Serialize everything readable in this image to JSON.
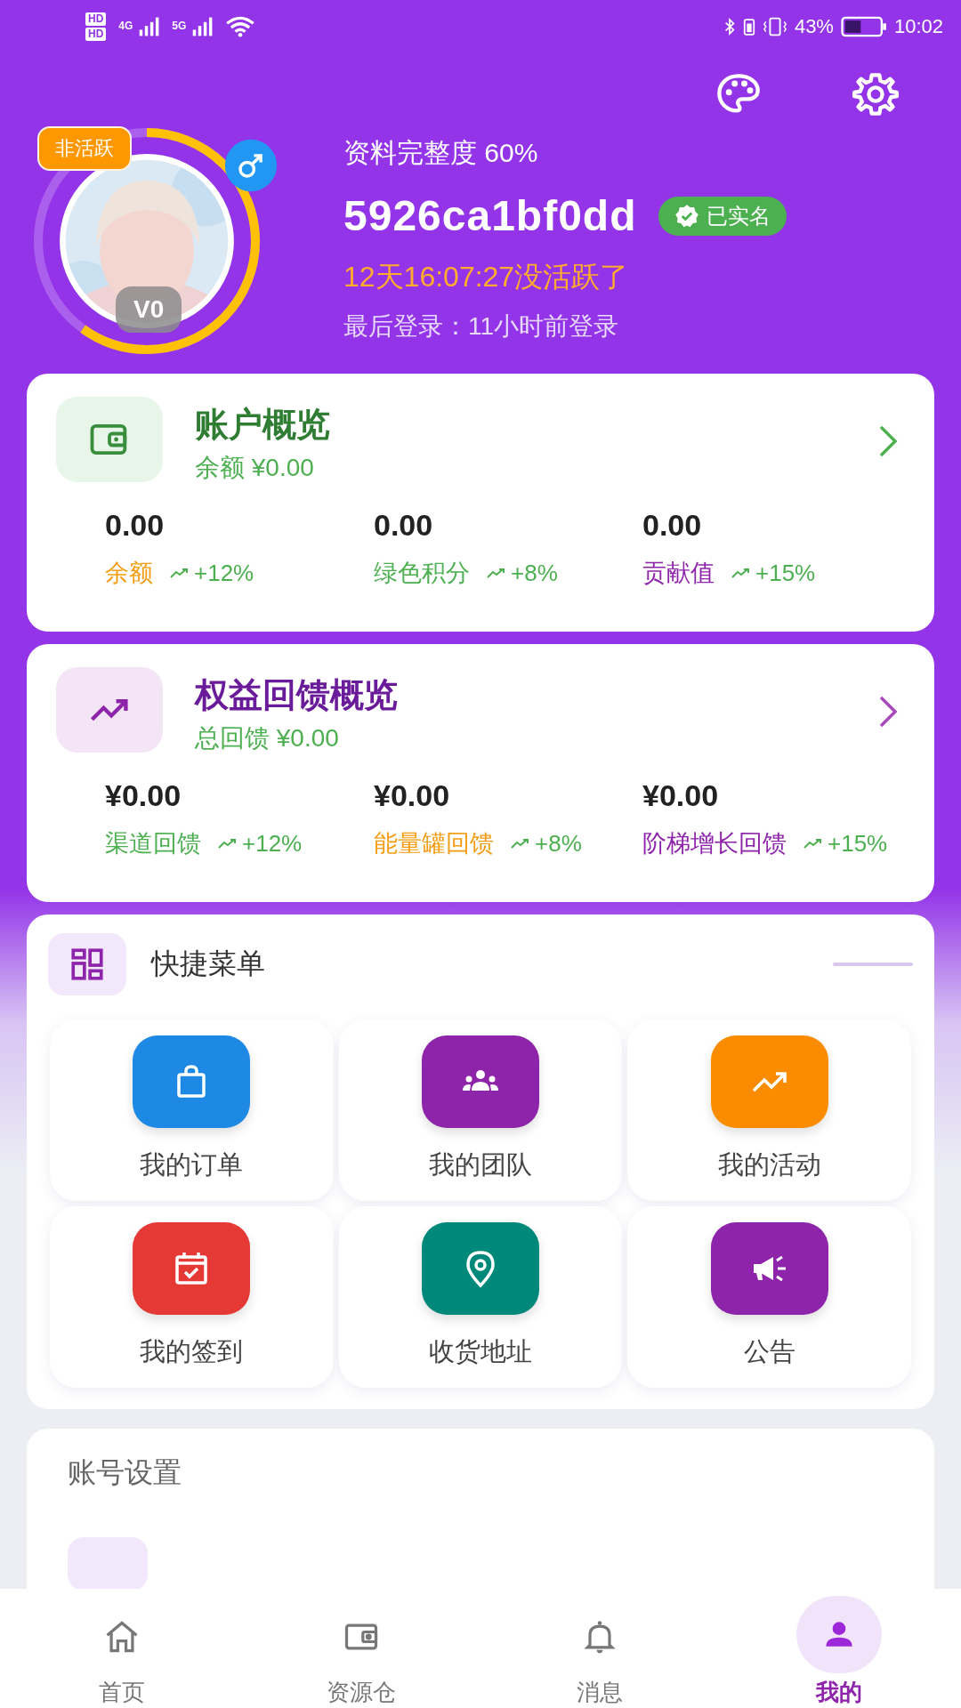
{
  "status_bar": {
    "sim_labels": [
      "HD",
      "HD"
    ],
    "network_labels": [
      "4G",
      "5G"
    ],
    "battery_text": "43%",
    "time": "10:02"
  },
  "profile": {
    "status_badge": "非活跃",
    "level_badge": "V0",
    "ring": {
      "level": 0.6
    },
    "completeness": "资料完整度 60%",
    "username": "5926ca1bf0dd",
    "verified": "已实名",
    "inactive_time": "12天16:07:27没活跃了",
    "last_login": "最后登录：11小时前登录"
  },
  "account_overview": {
    "title": "账户概览",
    "subtitle": "余额 ¥0.00",
    "stats": [
      {
        "value": "0.00",
        "label": "余额",
        "trend": "+12%",
        "color": "#f39c12"
      },
      {
        "value": "0.00",
        "label": "绿色积分",
        "trend": "+8%",
        "color": "#4caf50"
      },
      {
        "value": "0.00",
        "label": "贡献值",
        "trend": "+15%",
        "color": "#8e24aa"
      }
    ]
  },
  "rights_overview": {
    "title": "权益回馈概览",
    "subtitle": "总回馈 ¥0.00",
    "stats": [
      {
        "value": "¥0.00",
        "label": "渠道回馈",
        "trend": "+12%",
        "color": "#4caf50"
      },
      {
        "value": "¥0.00",
        "label": "能量罐回馈",
        "trend": "+8%",
        "color": "#f39c12"
      },
      {
        "value": "¥0.00",
        "label": "阶梯增长回馈",
        "trend": "+15%",
        "color": "#8e24aa"
      }
    ]
  },
  "quick_menu": {
    "title": "快捷菜单",
    "items": [
      {
        "label": "我的订单",
        "kind": "bag",
        "color": "#1e88e5"
      },
      {
        "label": "我的团队",
        "kind": "team",
        "color": "#8e24aa"
      },
      {
        "label": "我的活动",
        "kind": "trend",
        "color": "#fb8c00"
      },
      {
        "label": "我的签到",
        "kind": "calendar",
        "color": "#e53935"
      },
      {
        "label": "收货地址",
        "kind": "pin",
        "color": "#00897b"
      },
      {
        "label": "公告",
        "kind": "megaphone",
        "color": "#8e24aa"
      }
    ]
  },
  "account_settings": {
    "title": "账号设置"
  },
  "nav": [
    {
      "label": "首页",
      "selected": false
    },
    {
      "label": "资源仓",
      "selected": false
    },
    {
      "label": "消息",
      "selected": false
    },
    {
      "label": "我的",
      "selected": true
    }
  ]
}
